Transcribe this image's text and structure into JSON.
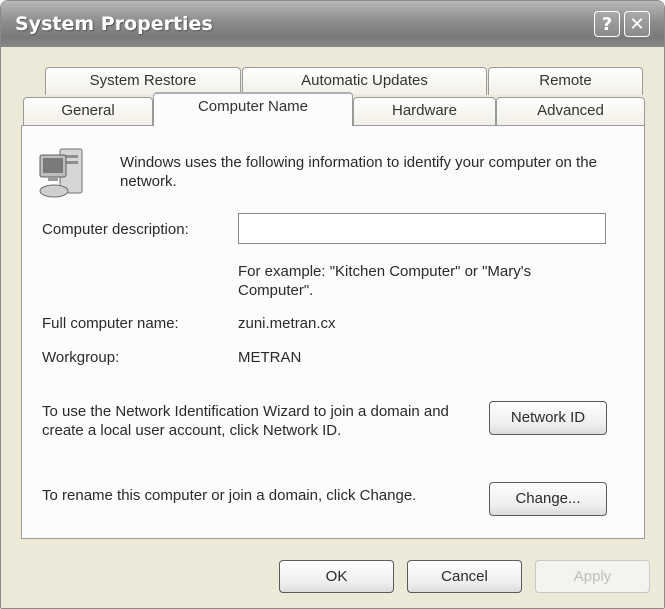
{
  "window": {
    "title": "System Properties",
    "help_glyph": "?",
    "close_glyph": "✕"
  },
  "tabs": {
    "row1": [
      "System Restore",
      "Automatic Updates",
      "Remote"
    ],
    "row2": [
      "General",
      "Computer Name",
      "Hardware",
      "Advanced"
    ],
    "active": "Computer Name"
  },
  "panel": {
    "intro_text": "Windows uses the following information to identify your computer on the network.",
    "description_label": "Computer description:",
    "description_value": "",
    "example_text": "For example: \"Kitchen Computer\" or \"Mary's Computer\".",
    "full_name_label": "Full computer name:",
    "full_name_value": "zuni.metran.cx",
    "workgroup_label": "Workgroup:",
    "workgroup_value": "METRAN",
    "network_id_text": "To use the Network Identification Wizard to join a domain and create a local user account, click Network ID.",
    "network_id_button": "Network ID",
    "rename_text": "To rename this computer or join a domain, click Change.",
    "change_button": "Change..."
  },
  "footer": {
    "ok_button": "OK",
    "cancel_button": "Cancel",
    "apply_button": "Apply"
  },
  "icons": {
    "computer": "computer-icon",
    "help": "help-icon",
    "close": "close-icon"
  },
  "colors": {
    "dialog_bg": "#ece9d8",
    "panel_bg": "#fcfcfe",
    "titlebar": "#8c8c8c"
  }
}
